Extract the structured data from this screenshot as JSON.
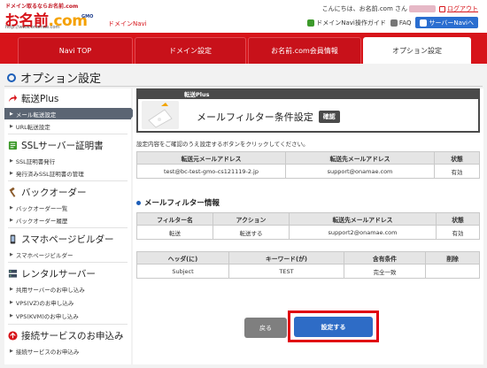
{
  "header": {
    "logo_tagline": "ドメイン取るならお名前.com",
    "logo_text_main": "お名前",
    "logo_text_dot": ".com",
    "logo_url": "http://www.onamae.com",
    "logo_gmo": "GMO",
    "brand": "ドメインNavi",
    "greeting_prefix": "こんにちは、お名前.com さん",
    "greeting_suffix": "",
    "logout": "ログアウト",
    "links": {
      "manual": "ドメインNavi操作ガイド",
      "faq": "FAQ",
      "server_navi": "サーバーNaviへ"
    }
  },
  "tabs": [
    {
      "label": "Navi TOP"
    },
    {
      "label": "ドメイン設定"
    },
    {
      "label": "お名前.com会員情報"
    },
    {
      "label": "オプション設定"
    }
  ],
  "page": {
    "title": "オプション設定"
  },
  "sidebar": {
    "sections": [
      {
        "label": "転送Plus",
        "items": [
          "メール転送設定",
          "URL転送設定"
        ]
      },
      {
        "label": "SSLサーバー証明書",
        "items": [
          "SSL証明書発行",
          "発行済みSSL証明書の管理"
        ]
      },
      {
        "label": "バックオーダー",
        "items": [
          "バックオーダー一覧",
          "バックオーダー履歴"
        ]
      },
      {
        "label": "スマホページビルダー",
        "items": [
          "スマホページビルダー"
        ]
      },
      {
        "label": "レンタルサーバー",
        "items": [
          "共用サーバーのお申し込み",
          "VPS(VZ)のお申し込み",
          "VPS(KVM)のお申し込み"
        ]
      },
      {
        "label": "接続サービスのお申込み",
        "items": [
          "接続サービスのお申込み"
        ]
      }
    ]
  },
  "banner": {
    "tag": "転送Plus",
    "title": "メールフィルター条件設定",
    "badge": "確認"
  },
  "instruction": "設定内容をご確認のうえ設定するボタンをクリックしてください。",
  "transfer_table": {
    "headers": [
      "転送元メールアドレス",
      "転送先メールアドレス",
      "状態"
    ],
    "rows": [
      [
        "test@bc-test-gmo-cs121119-2.jp",
        "support@onamae.com",
        "有効"
      ]
    ]
  },
  "filter_section": {
    "title": "メールフィルター情報"
  },
  "filter_table": {
    "headers": [
      "フィルター名",
      "アクション",
      "転送先メールアドレス",
      "状態"
    ],
    "rows": [
      [
        "転送",
        "転送する",
        "support2@onamae.com",
        "有効"
      ]
    ]
  },
  "condition_table": {
    "headers": [
      "ヘッダ(に)",
      "キーワード(が)",
      "含有条件",
      "削除"
    ],
    "rows": [
      [
        "Subject",
        "TEST",
        "完全一致",
        ""
      ]
    ]
  },
  "buttons": {
    "back": "戻る",
    "submit": "設定する"
  },
  "colors": {
    "brand_red": "#d7141a",
    "accent_blue": "#2e6cc6",
    "highlight": "#e00012"
  }
}
